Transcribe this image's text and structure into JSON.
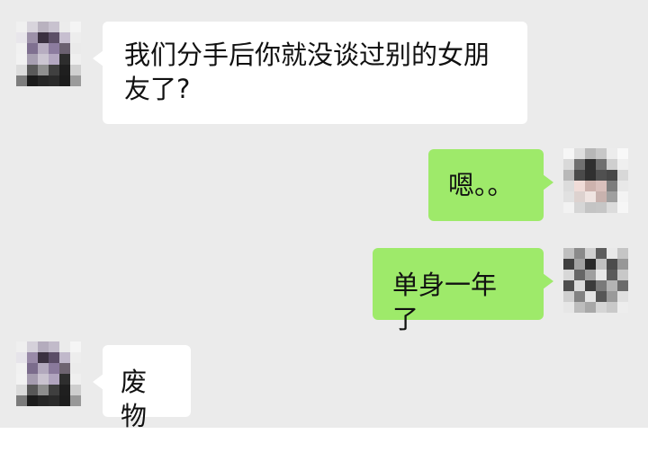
{
  "colors": {
    "background": "#ebebeb",
    "incoming_bubble": "#ffffff",
    "outgoing_bubble": "#9eea6a",
    "text": "#111111"
  },
  "messages": [
    {
      "from": "contact",
      "text": "我们分手后你就没谈过别的女朋\n友了?",
      "avatar": "pixelated-avatar"
    },
    {
      "from": "self",
      "text": "嗯。。",
      "avatar": "pixelated-avatar"
    },
    {
      "from": "self",
      "text": "单身一年了",
      "avatar": "pixelated-avatar"
    },
    {
      "from": "contact",
      "text": "废物",
      "avatar": "pixelated-avatar"
    }
  ]
}
